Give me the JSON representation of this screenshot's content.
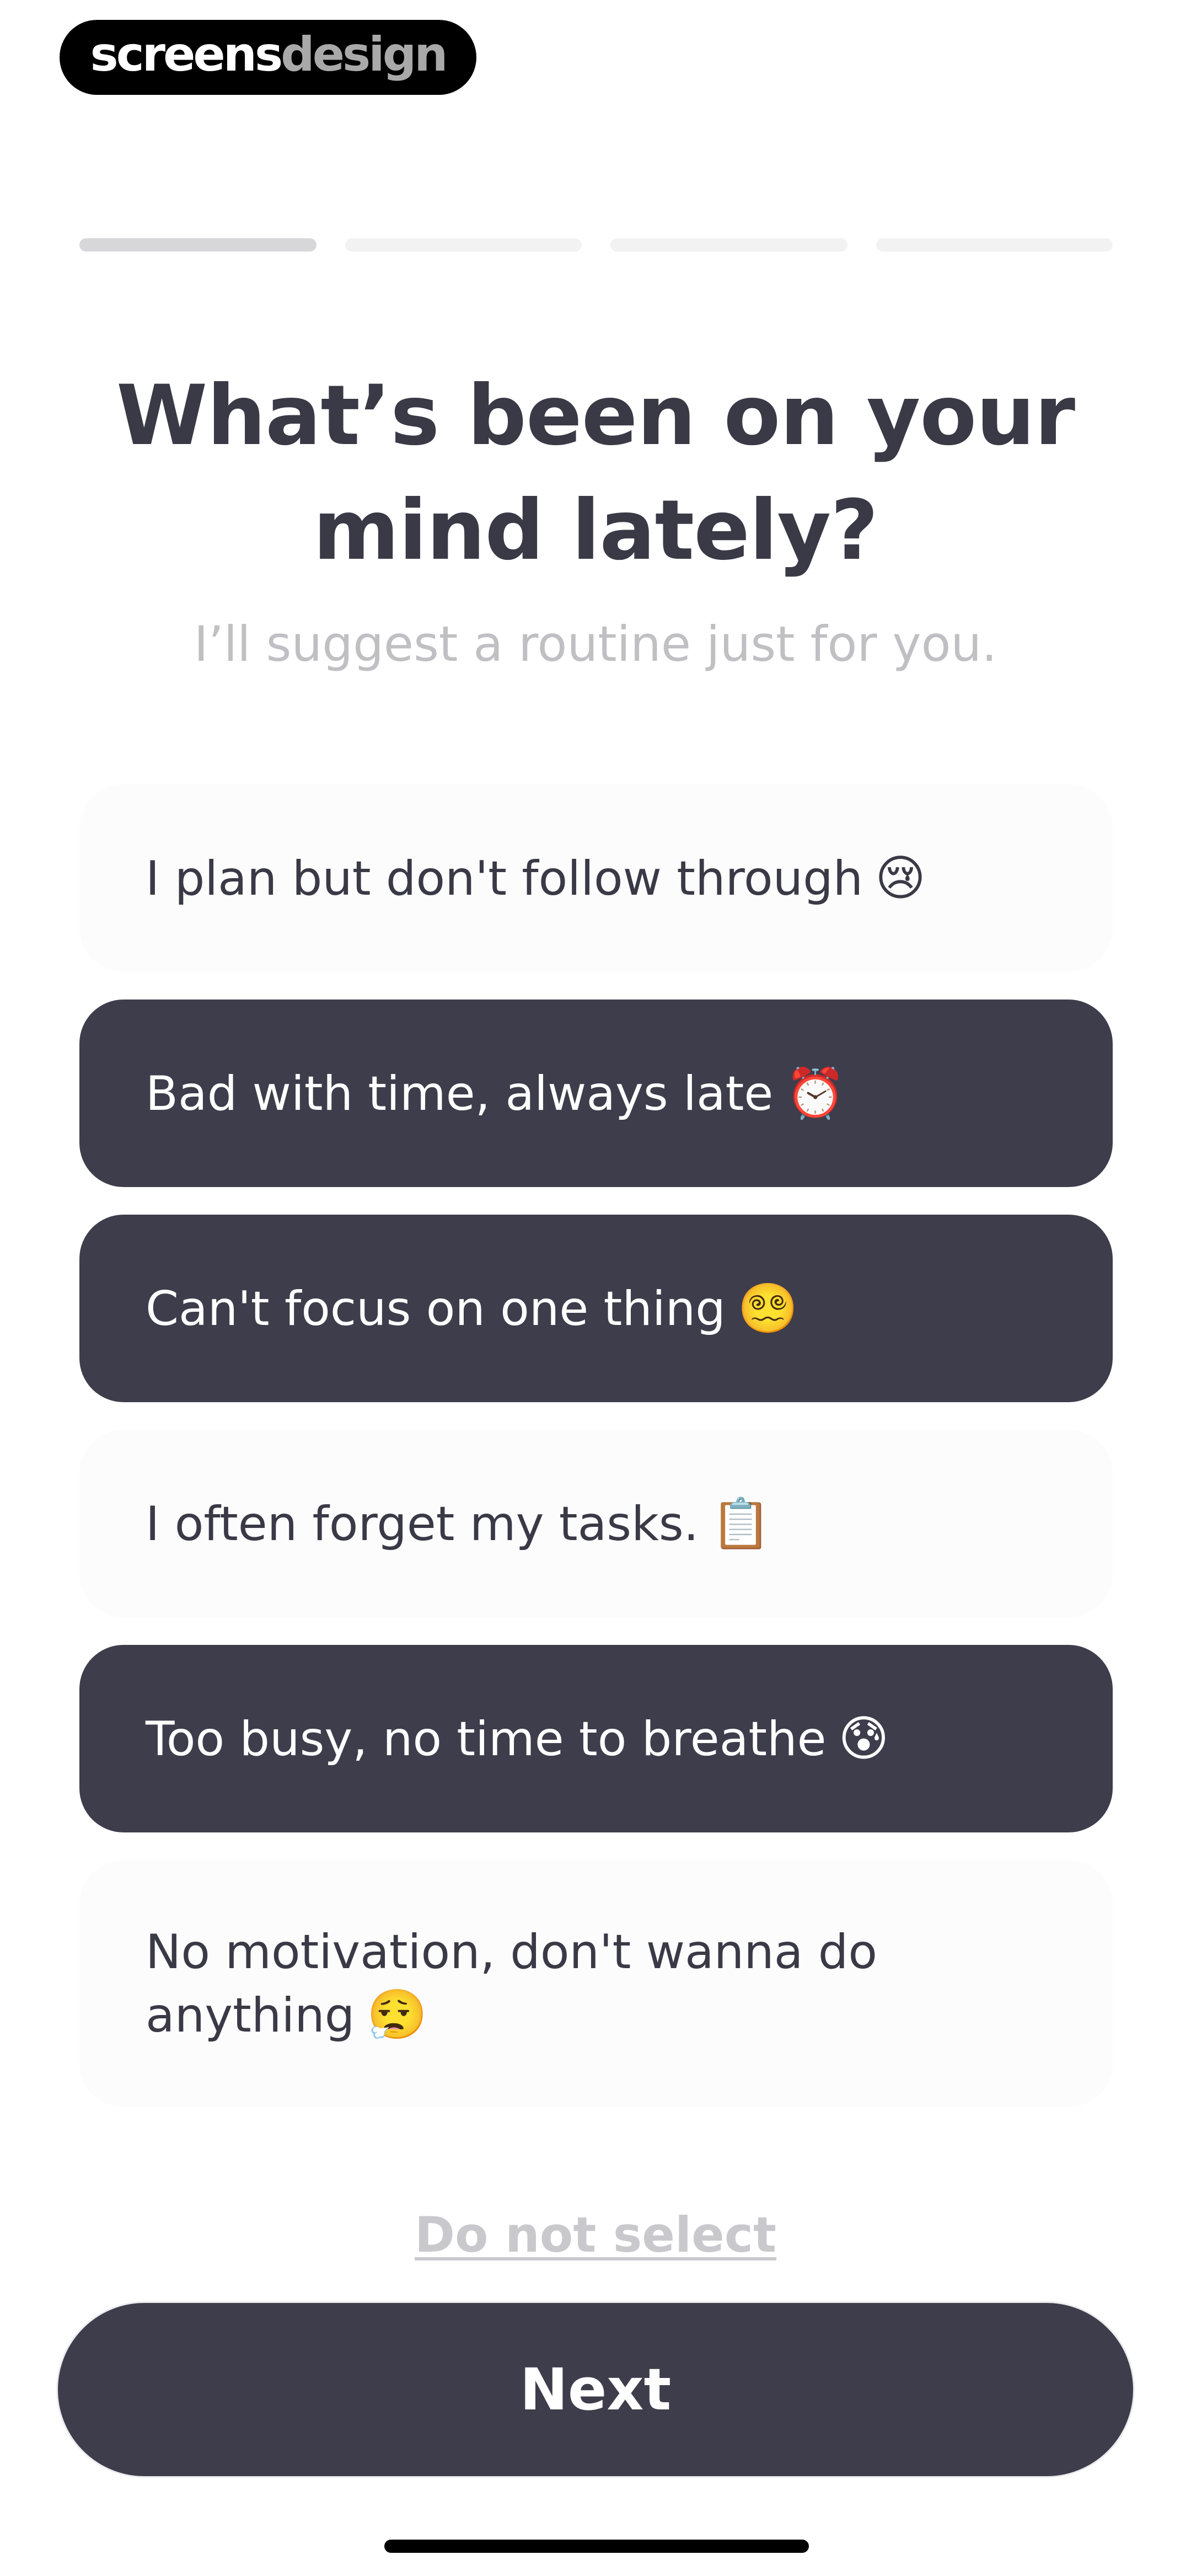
{
  "brand": {
    "part1": "screens",
    "part2": "design"
  },
  "progress": {
    "total_steps": 4,
    "current_step": 1
  },
  "question": {
    "title": "What’s been on your mind lately?",
    "subtitle": "I’ll suggest a routine just for you."
  },
  "options": [
    {
      "label": "I plan but don't follow through",
      "emoji": "😢",
      "selected": false
    },
    {
      "label": "Bad with time, always late",
      "emoji": "⏰",
      "selected": true
    },
    {
      "label": "Can't focus on one thing",
      "emoji": "😵‍💫",
      "selected": true
    },
    {
      "label": "I often forget my tasks.",
      "emoji": "📋",
      "selected": false
    },
    {
      "label": "Too busy, no time to breathe",
      "emoji": "😰",
      "selected": true
    },
    {
      "label": "No motivation, don't wanna do anything",
      "emoji": "😮‍💨",
      "selected": false
    }
  ],
  "skip_label": "Do not select",
  "next_label": "Next",
  "colors": {
    "dark": "#3e3d4b",
    "title_text": "#3a3946",
    "subtitle_text": "#c0c0c4",
    "option_bg": "#fcfcfd",
    "progress_active": "#d7d7da",
    "progress_inactive": "#f2f2f3"
  }
}
